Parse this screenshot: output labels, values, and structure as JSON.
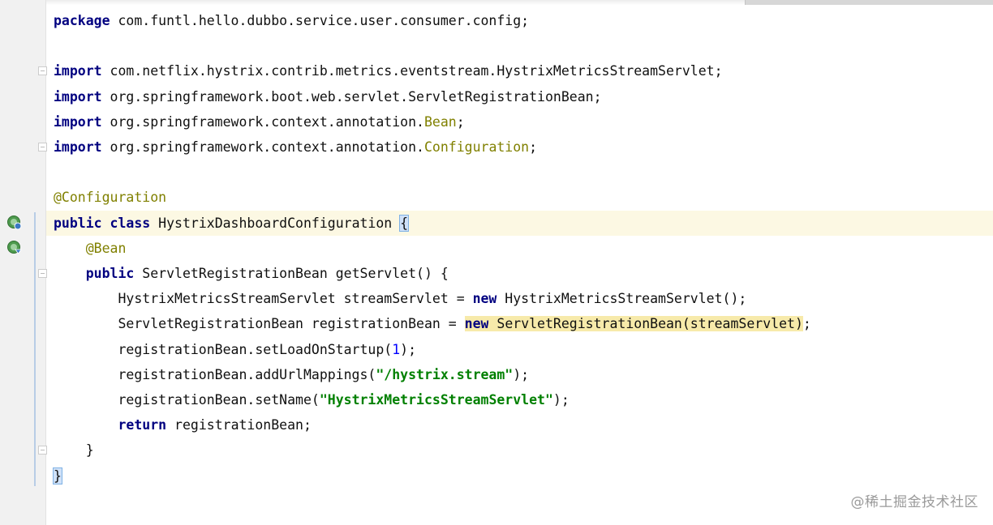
{
  "editor": {
    "language": "java",
    "lines": [
      {
        "n": 1,
        "segments": [
          {
            "t": "package",
            "c": "kw"
          },
          {
            "t": " com.funtl.hello.dubbo.service.user.consumer.config;",
            "c": "ident"
          }
        ]
      },
      {
        "n": 2,
        "segments": []
      },
      {
        "n": 3,
        "segments": [
          {
            "t": "import",
            "c": "kw"
          },
          {
            "t": " com.netflix.hystrix.contrib.metrics.eventstream.HystrixMetricsStreamServlet;",
            "c": "ident"
          }
        ]
      },
      {
        "n": 4,
        "segments": [
          {
            "t": "import",
            "c": "kw"
          },
          {
            "t": " org.springframework.boot.web.servlet.ServletRegistrationBean;",
            "c": "ident"
          }
        ]
      },
      {
        "n": 5,
        "segments": [
          {
            "t": "import",
            "c": "kw"
          },
          {
            "t": " org.springframework.context.annotation.",
            "c": "ident"
          },
          {
            "t": "Bean",
            "c": "ann"
          },
          {
            "t": ";",
            "c": "ident"
          }
        ]
      },
      {
        "n": 6,
        "segments": [
          {
            "t": "import",
            "c": "kw"
          },
          {
            "t": " org.springframework.context.annotation.",
            "c": "ident"
          },
          {
            "t": "Configuration",
            "c": "ann"
          },
          {
            "t": ";",
            "c": "ident"
          }
        ]
      },
      {
        "n": 7,
        "segments": []
      },
      {
        "n": 8,
        "segments": [
          {
            "t": "@Configuration",
            "c": "ann"
          }
        ]
      },
      {
        "n": 9,
        "segments": [
          {
            "t": "public",
            "c": "kw"
          },
          {
            "t": " ",
            "c": "ident"
          },
          {
            "t": "class",
            "c": "kw"
          },
          {
            "t": " HystrixDashboardConfiguration ",
            "c": "ident"
          },
          {
            "t": "{",
            "c": "ident brace-match"
          }
        ]
      },
      {
        "n": 10,
        "segments": [
          {
            "t": "    ",
            "c": "ident"
          },
          {
            "t": "@Bean",
            "c": "ann"
          }
        ]
      },
      {
        "n": 11,
        "segments": [
          {
            "t": "    ",
            "c": "ident"
          },
          {
            "t": "public",
            "c": "kw"
          },
          {
            "t": " ServletRegistrationBean getServlet() {",
            "c": "ident"
          }
        ]
      },
      {
        "n": 12,
        "segments": [
          {
            "t": "        HystrixMetricsStreamServlet streamServlet = ",
            "c": "ident"
          },
          {
            "t": "new",
            "c": "kw"
          },
          {
            "t": " HystrixMetricsStreamServlet();",
            "c": "ident"
          }
        ]
      },
      {
        "n": 13,
        "segments": [
          {
            "t": "        ServletRegistrationBean registrationBean = ",
            "c": "ident"
          },
          {
            "t": "new",
            "c": "kw hl-usage"
          },
          {
            "t": " ServletRegistrationBean(streamServlet)",
            "c": "ident hl-usage"
          },
          {
            "t": ";",
            "c": "ident"
          }
        ]
      },
      {
        "n": 14,
        "segments": [
          {
            "t": "        registrationBean.setLoadOnStartup(",
            "c": "ident"
          },
          {
            "t": "1",
            "c": "num"
          },
          {
            "t": ");",
            "c": "ident"
          }
        ]
      },
      {
        "n": 15,
        "segments": [
          {
            "t": "        registrationBean.addUrlMappings(",
            "c": "ident"
          },
          {
            "t": "\"/hystrix.stream\"",
            "c": "str"
          },
          {
            "t": ");",
            "c": "ident"
          }
        ]
      },
      {
        "n": 16,
        "segments": [
          {
            "t": "        registrationBean.setName(",
            "c": "ident"
          },
          {
            "t": "\"HystrixMetricsStreamServlet\"",
            "c": "str"
          },
          {
            "t": ");",
            "c": "ident"
          }
        ]
      },
      {
        "n": 17,
        "segments": [
          {
            "t": "        ",
            "c": "ident"
          },
          {
            "t": "return",
            "c": "kw"
          },
          {
            "t": " registrationBean;",
            "c": "ident"
          }
        ]
      },
      {
        "n": 18,
        "segments": [
          {
            "t": "    }",
            "c": "ident"
          }
        ]
      },
      {
        "n": 19,
        "segments": [
          {
            "t": "}",
            "c": "ident brace-match"
          }
        ]
      }
    ]
  },
  "gutter": {
    "markers": [
      {
        "line": 9,
        "icon": "spring-bean-icon"
      },
      {
        "line": 10,
        "icon": "spring-bean-method-icon"
      }
    ],
    "folds": [
      3,
      6,
      11,
      18
    ]
  },
  "watermark": "@稀土掘金技术社区",
  "colors": {
    "keyword": "#000080",
    "annotation": "#808000",
    "string": "#008000",
    "number": "#0000ff",
    "caret_row": "#fcf8e3",
    "usage_highlight": "#f7eaaa"
  }
}
